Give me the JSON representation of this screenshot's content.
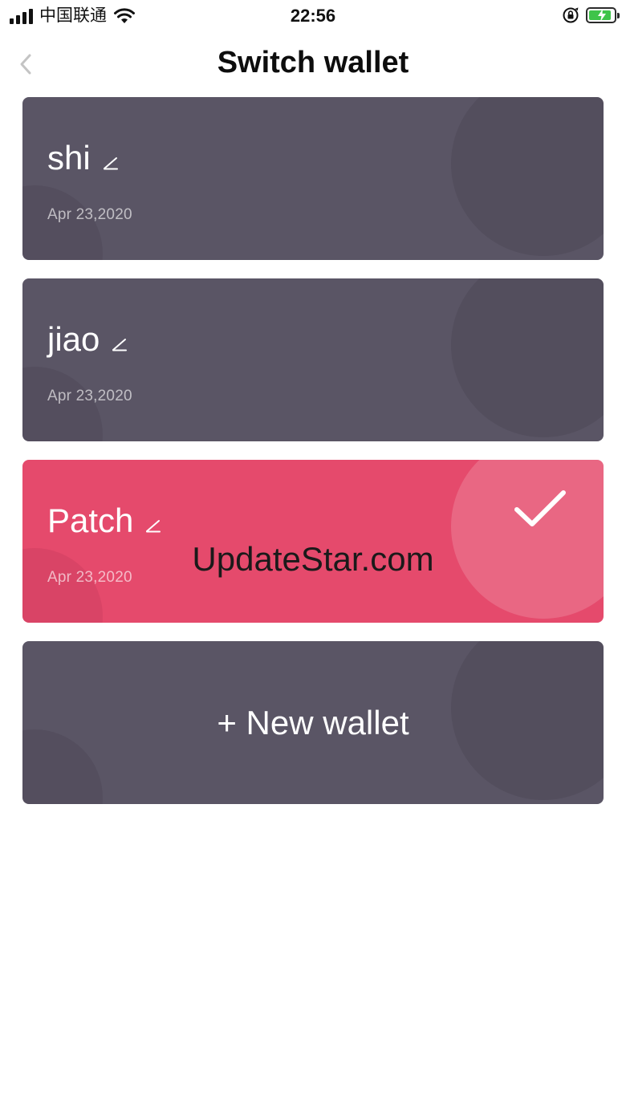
{
  "status_bar": {
    "carrier": "中国联通",
    "time": "22:56",
    "signal_bars": 4,
    "battery_level": 0.9,
    "icons": [
      "signal-icon",
      "wifi-icon",
      "orientation-lock-icon",
      "battery-charging-icon"
    ]
  },
  "header": {
    "title": "Switch wallet",
    "back_icon": "chevron-left-icon"
  },
  "wallets": [
    {
      "name": "shi",
      "date": "Apr 23,2020",
      "selected": false
    },
    {
      "name": "jiao",
      "date": "Apr 23,2020",
      "selected": false
    },
    {
      "name": "Patch",
      "date": "Apr 23,2020",
      "selected": true
    }
  ],
  "new_wallet": {
    "label": "+ New wallet"
  },
  "watermark": "UpdateStar.com",
  "colors": {
    "card": "#5a5565",
    "card_active": "#e54a6c",
    "title": "#0d0d0d",
    "battery": "#3fc44a"
  }
}
